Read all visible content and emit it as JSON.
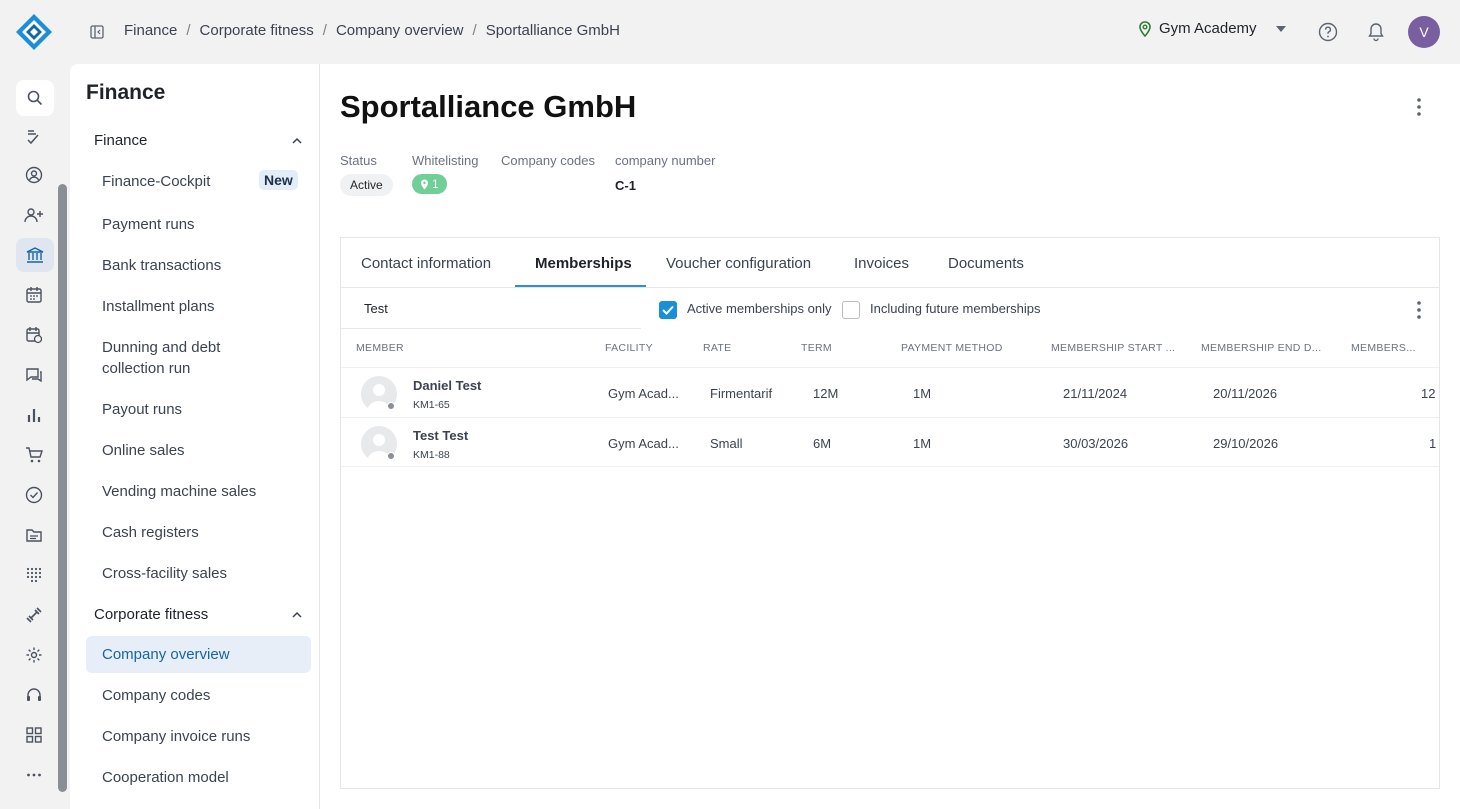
{
  "breadcrumb": [
    "Finance",
    "Corporate fitness",
    "Company overview",
    "Sportalliance GmbH"
  ],
  "studio": "Gym Academy",
  "user_initial": "V",
  "sidebar": {
    "title": "Finance",
    "section_finance": "Finance",
    "items_finance": [
      "Finance-Cockpit",
      "Payment runs",
      "Bank transactions",
      "Installment plans",
      "Dunning and debt collection run",
      "Payout runs",
      "Online sales",
      "Vending machine sales",
      "Cash registers",
      "Cross-facility sales"
    ],
    "new_badge": "New",
    "section_corporate": "Corporate fitness",
    "items_corporate": [
      "Company overview",
      "Company codes",
      "Company invoice runs",
      "Cooperation model"
    ]
  },
  "page": {
    "title": "Sportalliance GmbH",
    "meta_labels": [
      "Status",
      "Whitelisting",
      "Company codes",
      "company number"
    ],
    "status": "Active",
    "whitelisting_count": "1",
    "company_number": "C-1"
  },
  "tabs": [
    "Contact information",
    "Memberships",
    "Voucher configuration",
    "Invoices",
    "Documents"
  ],
  "filter": {
    "search_value": "Test",
    "active_only_label": "Active memberships only",
    "future_label": "Including future memberships"
  },
  "table": {
    "headers": [
      "MEMBER",
      "FACILITY",
      "RATE",
      "TERM",
      "PAYMENT METHOD",
      "MEMBERSHIP START ...",
      "MEMBERSHIP END D...",
      "MEMBERS..."
    ],
    "rows": [
      {
        "name": "Daniel Test",
        "id": "KM1-65",
        "facility": "Gym Acad...",
        "rate": "Firmentarif",
        "term": "12M",
        "payment": "1M",
        "start": "21/11/2024",
        "end": "20/11/2026",
        "members": "12"
      },
      {
        "name": "Test Test",
        "id": "KM1-88",
        "facility": "Gym Acad...",
        "rate": "Small",
        "term": "6M",
        "payment": "1M",
        "start": "30/03/2026",
        "end": "29/10/2026",
        "members": "1"
      }
    ]
  }
}
